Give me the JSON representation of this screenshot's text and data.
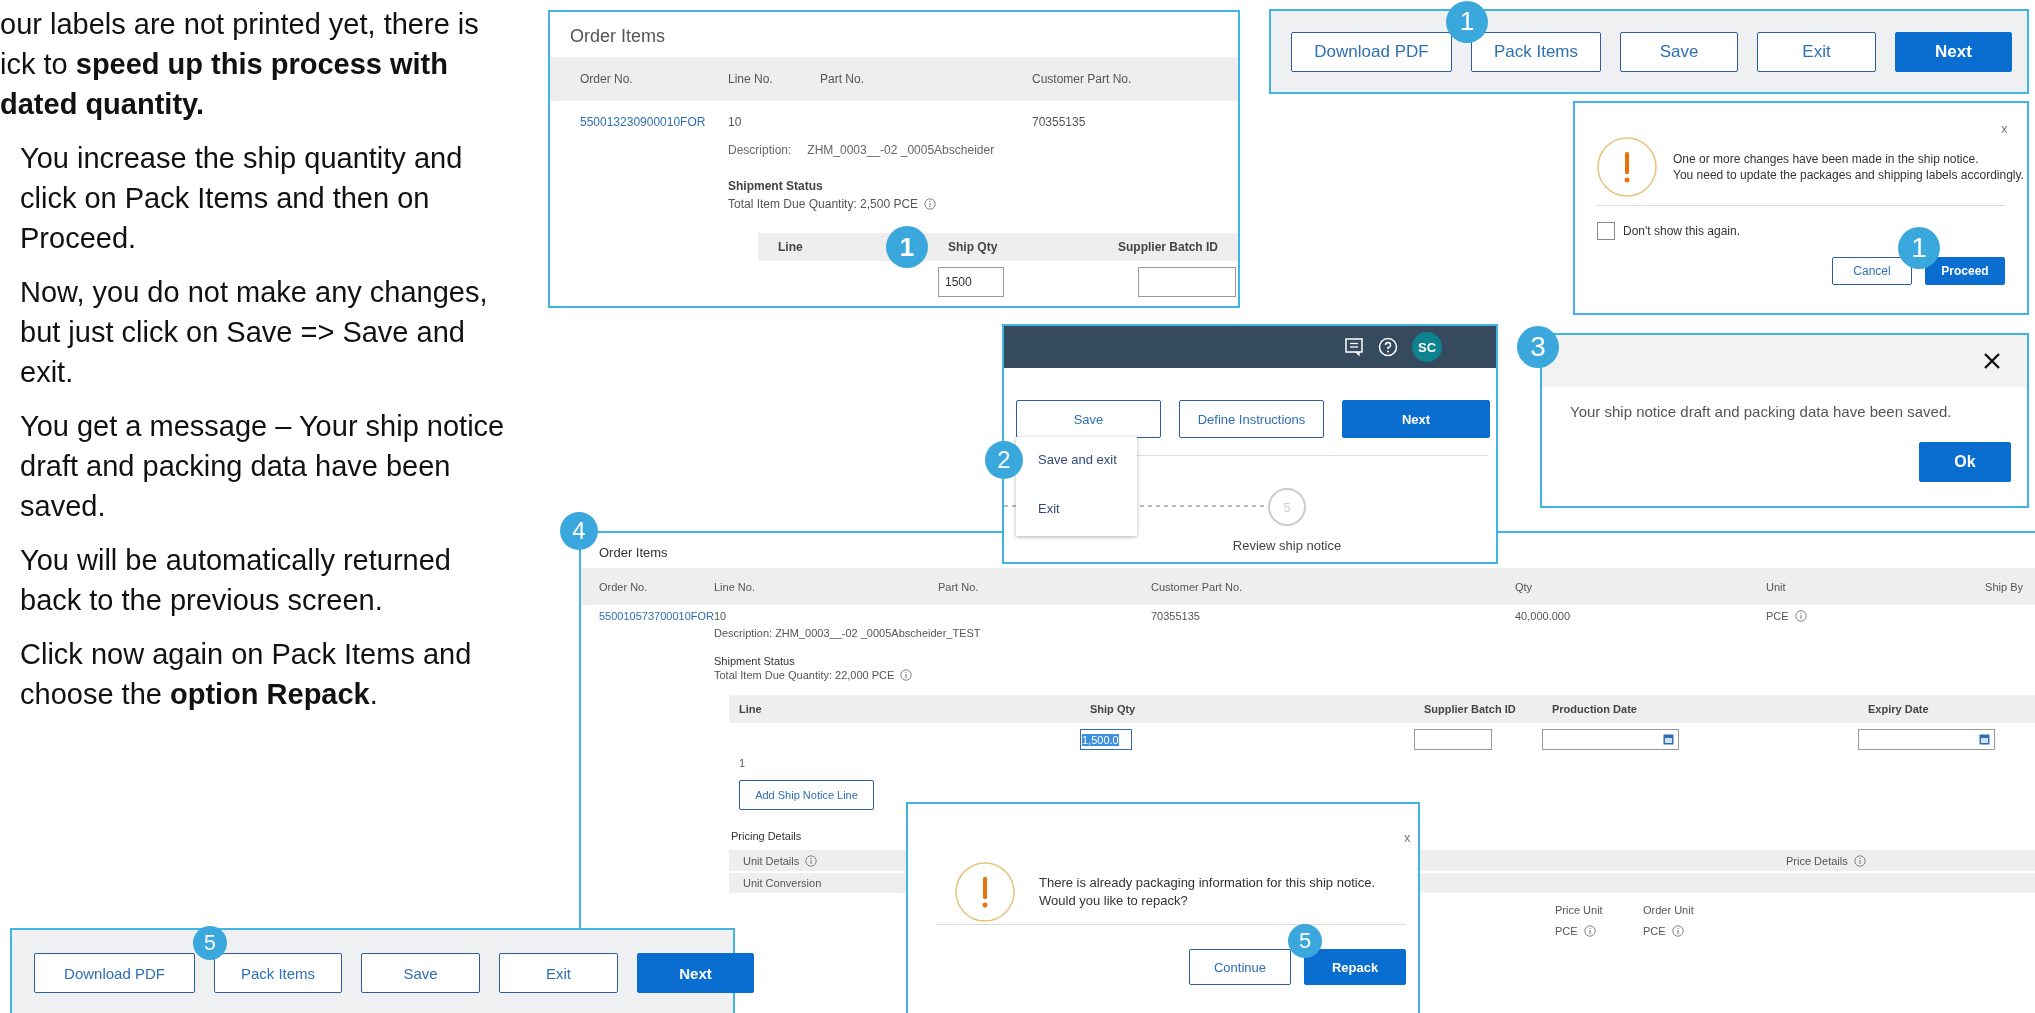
{
  "instructions": {
    "intro": [
      "our labels are not printed yet, there is",
      "ick to **speed up this process with**",
      "**dated quantity.**"
    ],
    "steps": [
      "You increase the ship quantity and click on Pack Items and then on Proceed.",
      "Now, you do not make any changes, but just click on Save => Save and exit.",
      "You get a message – Your ship notice draft and packing data have been saved.",
      "You will be automatically returned back to the previous screen.",
      "Click now again on Pack Items and choose the **option Repack**."
    ]
  },
  "order_items_small": {
    "title": "Order Items",
    "columns": [
      "Order No.",
      "Line No.",
      "Part No.",
      "Customer Part No."
    ],
    "row": {
      "order_no": "550013230900010FOR",
      "line_no": "10",
      "customer_part_no": "70355135",
      "description_label": "Description:",
      "description": "ZHM_0003__-02 _0005Abscheider",
      "status_title": "Shipment Status",
      "due_quantity": "Total Item Due Quantity: 2,500 PCE"
    },
    "subtable": {
      "columns": [
        "Line",
        "Ship Qty",
        "Supplier Batch ID"
      ],
      "ship_qty": "1500",
      "badge": "1"
    }
  },
  "action_bar_top": {
    "badge": "1",
    "buttons": [
      {
        "label": "Download PDF",
        "kind": "secondary"
      },
      {
        "label": "Pack Items",
        "kind": "secondary"
      },
      {
        "label": "Save",
        "kind": "secondary"
      },
      {
        "label": "Exit",
        "kind": "secondary"
      },
      {
        "label": "Next",
        "kind": "primary"
      }
    ]
  },
  "changes_dialog": {
    "close": "x",
    "message": [
      "One or more changes have been made in the ship notice.",
      "You need to update the packages and shipping labels accordingly."
    ],
    "checkbox": {
      "label": "Don't show this again.",
      "checked": false
    },
    "badge": "1",
    "buttons": [
      {
        "label": "Cancel",
        "kind": "secondary"
      },
      {
        "label": "Proceed",
        "kind": "primary"
      }
    ]
  },
  "save_menu_screen": {
    "avatar": "SC",
    "badge": "2",
    "buttons": [
      {
        "label": "Save",
        "kind": "secondary"
      },
      {
        "label": "Define Instructions",
        "kind": "secondary"
      },
      {
        "label": "Next",
        "kind": "primary"
      }
    ],
    "menu": [
      "Save and exit",
      "Exit"
    ],
    "step": {
      "number": "5",
      "label": "Review ship notice"
    }
  },
  "saved_dialog": {
    "badge": "3",
    "message": "Your ship notice draft and packing data have been saved.",
    "button": "Ok"
  },
  "order_items_large": {
    "badge": "4",
    "title": "Order Items",
    "columns": [
      "Order No.",
      "Line No.",
      "Part No.",
      "Customer Part No.",
      "Qty",
      "Unit",
      "Ship By"
    ],
    "row": {
      "order_no": "550010573700010FOR",
      "line_no": "10",
      "customer_part_no": "70355135",
      "qty": "40,000.000",
      "unit": "PCE",
      "description": "Description: ZHM_0003__-02 _0005Abscheider_TEST",
      "status_title": "Shipment Status",
      "due_quantity": "Total Item Due Quantity: 22,000 PCE"
    },
    "subtable": {
      "columns": [
        "Line",
        "Ship Qty",
        "Supplier Batch ID",
        "Production Date",
        "Expiry Date"
      ],
      "line": "1",
      "ship_qty": "1,500.0"
    },
    "add_line_button": "Add Ship Notice Line",
    "pricing": {
      "title": "Pricing Details",
      "unit_details": "Unit Details",
      "price_details": "Price Details",
      "unit_conversion": "Unit Conversion",
      "price_unit": "Price Unit",
      "order_unit": "Order Unit",
      "price_unit_value": "PCE",
      "order_unit_value": "PCE"
    }
  },
  "repack_dialog": {
    "close": "x",
    "message": [
      "There is already packaging information for this ship notice.",
      "Would you like to repack?"
    ],
    "badge": "5",
    "buttons": [
      {
        "label": "Continue",
        "kind": "secondary"
      },
      {
        "label": "Repack",
        "kind": "primary"
      }
    ]
  },
  "action_bar_bottom": {
    "badge": "5",
    "buttons": [
      {
        "label": "Download PDF",
        "kind": "secondary"
      },
      {
        "label": "Pack Items",
        "kind": "secondary"
      },
      {
        "label": "Save",
        "kind": "secondary"
      },
      {
        "label": "Exit",
        "kind": "secondary"
      },
      {
        "label": "Next",
        "kind": "primary"
      }
    ]
  }
}
